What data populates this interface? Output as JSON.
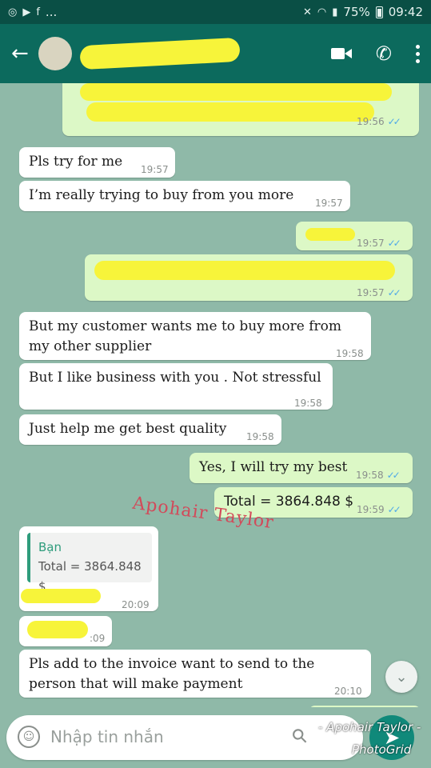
{
  "status_bar": {
    "left_dots": "...",
    "battery": "75%",
    "clock": "09:42"
  },
  "messages": [
    {
      "id": "m1",
      "dir": "out",
      "text": "",
      "time": "19:56"
    },
    {
      "id": "m2",
      "dir": "in",
      "text": "Pls try for me",
      "time": "19:57"
    },
    {
      "id": "m3",
      "dir": "in",
      "text": "I’m really trying to buy from you more",
      "time": "19:57"
    },
    {
      "id": "m4",
      "dir": "out",
      "text": "",
      "time": "19:57"
    },
    {
      "id": "m5",
      "dir": "out",
      "text": "",
      "time": "19:57"
    },
    {
      "id": "m6",
      "dir": "in",
      "lines": [
        "But my customer wants me to buy more from",
        "my other supplier"
      ],
      "time": "19:58"
    },
    {
      "id": "m7",
      "dir": "in",
      "text": "But I like business with you . Not stressful",
      "time": "19:58"
    },
    {
      "id": "m8",
      "dir": "in",
      "text": "Just help me get best quality",
      "time": "19:58"
    },
    {
      "id": "m9",
      "dir": "out",
      "text": "Yes, I will try my best",
      "time": "19:58"
    },
    {
      "id": "m10",
      "dir": "out",
      "text": "Total = 3864.848 $",
      "time": "19:59"
    },
    {
      "id": "m11",
      "dir": "in",
      "quote_author": "Bạn",
      "quote_text": "Total = 3864.848 $",
      "time": "20:09"
    },
    {
      "id": "m12",
      "dir": "in",
      "text": "",
      "time": ":09"
    },
    {
      "id": "m13",
      "dir": "in",
      "lines": [
        "Pls add to the invoice want to send to the",
        "person that will make payment"
      ],
      "time": "20:10"
    }
  ],
  "watermark": "Apohair Taylor",
  "input": {
    "placeholder": "Nhập tin nhắn"
  },
  "credit": {
    "line1": "- Apohair Taylor -",
    "line2": "PhotoGrid"
  },
  "icons": {
    "back": "arrow-left-icon",
    "video": "video-call-icon",
    "call": "phone-icon",
    "menu": "kebab-menu-icon",
    "emoji": "emoji-icon",
    "attach": "paperclip-icon",
    "send": "send-icon",
    "scroll": "chevron-down-icon"
  },
  "colors": {
    "header": "#0c6a5d",
    "chat_bg": "#8fb9a8",
    "incoming": "#ffffff",
    "outgoing": "#dcf8c6",
    "read_ticks": "#4fa9e8",
    "redaction": "#f7f43a",
    "watermark": "#d24a5a"
  }
}
